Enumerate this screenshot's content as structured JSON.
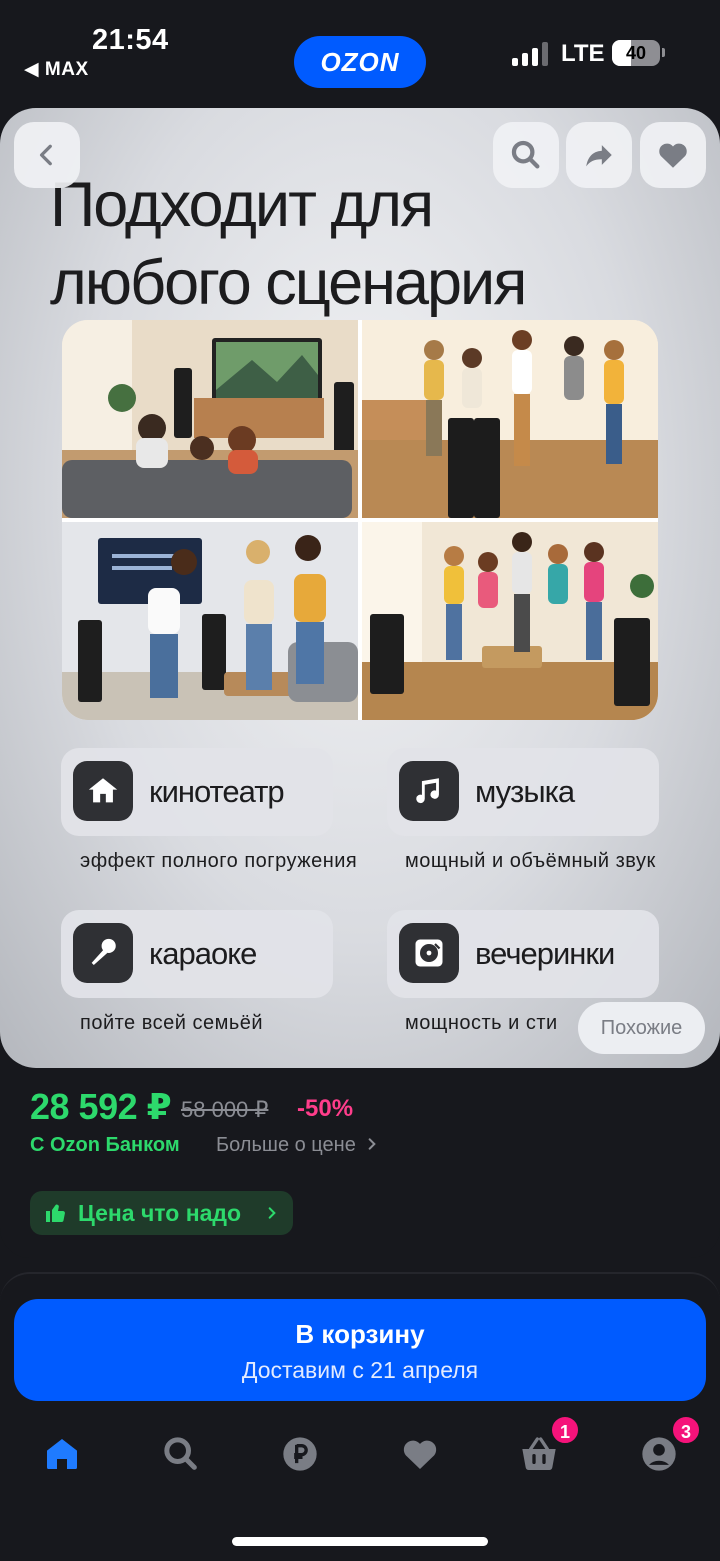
{
  "status_bar": {
    "time": "21:54",
    "back_app": "◀ MAX",
    "network": "LTE",
    "battery": "40"
  },
  "app": {
    "logo": "OZON",
    "brand_color": "#005bff"
  },
  "toolbar": {
    "back_icon": "chevron-left-icon",
    "search_icon": "search-icon",
    "share_icon": "share-icon",
    "favorite_icon": "heart-icon"
  },
  "slide": {
    "headline_line1": "Подходит для",
    "headline_line2": "любого сценария",
    "features": [
      {
        "icon": "home-icon",
        "label": "кинотеатр",
        "description": "эффект полного погружения"
      },
      {
        "icon": "music-note-icon",
        "label": "музыка",
        "description": "мощный и объёмный звук"
      },
      {
        "icon": "microphone-icon",
        "label": "караоке",
        "description": "пойте всей семьёй"
      },
      {
        "icon": "vinyl-icon",
        "label": "вечеринки",
        "description": "мощность и сти"
      }
    ]
  },
  "similar_button": "Похожие",
  "price": {
    "current": "28 592 ₽",
    "old": "58 000 ₽",
    "discount": "-50%",
    "bank_label": "С Ozon Банком",
    "more_link": "Больше о цене",
    "badge": "Цена что надо",
    "price_color": "#2dd96c",
    "discount_color": "#ff3d8b"
  },
  "cart": {
    "title": "В корзину",
    "subtitle": "Доставим с 21 апреля"
  },
  "tabbar": {
    "items": [
      {
        "icon": "home-icon",
        "active": true
      },
      {
        "icon": "search-icon",
        "active": false
      },
      {
        "icon": "ruble-icon",
        "active": false
      },
      {
        "icon": "heart-icon",
        "active": false
      },
      {
        "icon": "basket-icon",
        "badge": "1",
        "active": false
      },
      {
        "icon": "profile-icon",
        "badge": "3",
        "active": false
      }
    ]
  }
}
